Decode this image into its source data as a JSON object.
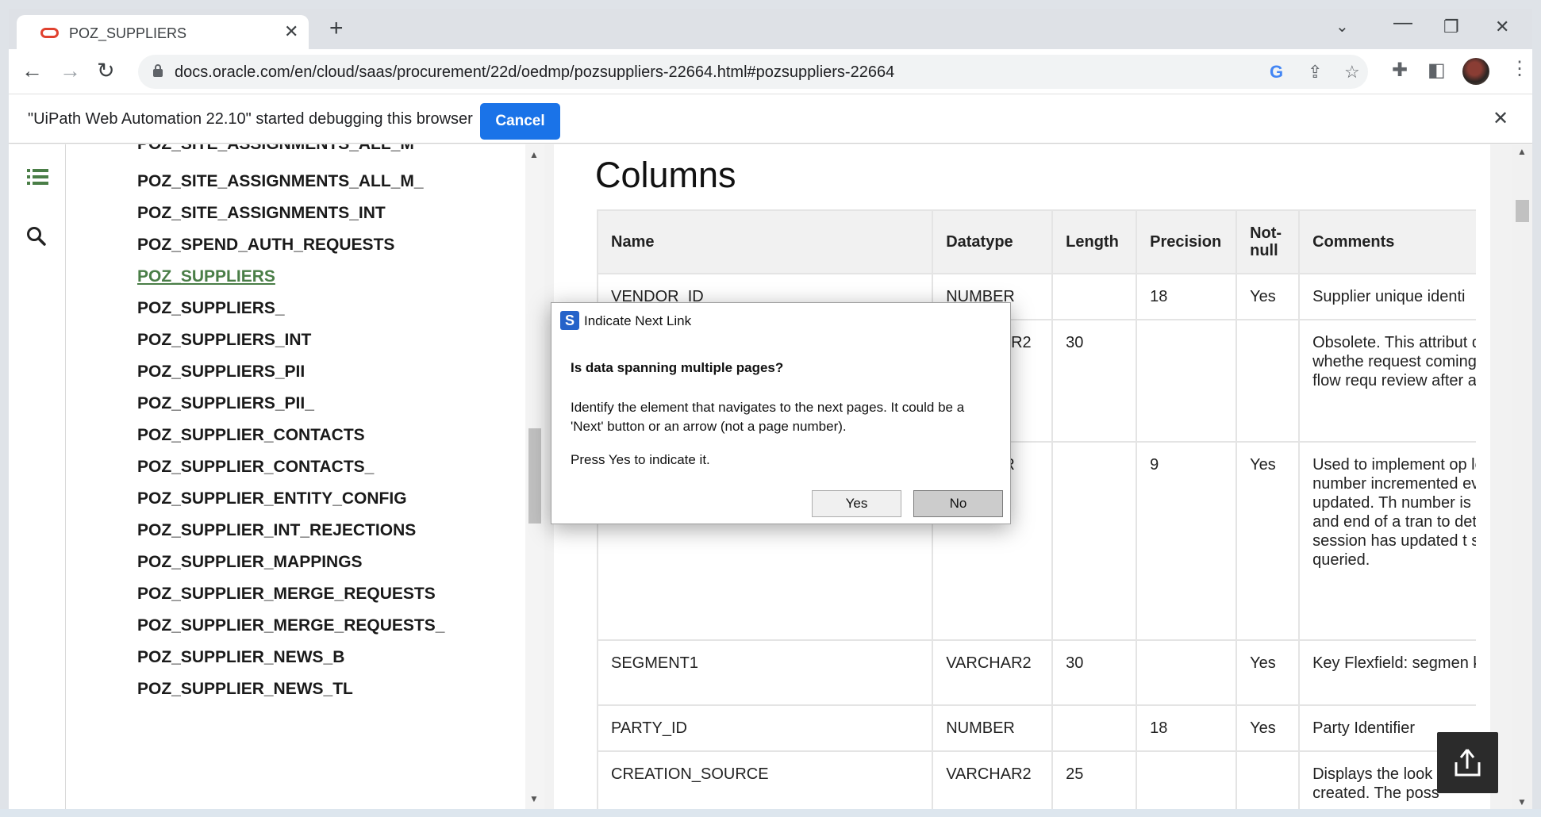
{
  "browser": {
    "tab_title": "POZ_SUPPLIERS",
    "tab_close": "✕",
    "new_tab": "+",
    "url": "docs.oracle.com/en/cloud/saas/procurement/22d/oedmp/pozsuppliers-22664.html#pozsuppliers-22664",
    "accent_color": "#1a73e8"
  },
  "infobar": {
    "message": "\"UiPath Web Automation 22.10\" started debugging this browser",
    "cancel_label": "Cancel"
  },
  "sidebar": {
    "items": [
      {
        "label": "POZ_SITE_ASSIGNMENTS_ALL_M"
      },
      {
        "label": "POZ_SITE_ASSIGNMENTS_ALL_M_"
      },
      {
        "label": "POZ_SITE_ASSIGNMENTS_INT"
      },
      {
        "label": "POZ_SPEND_AUTH_REQUESTS"
      },
      {
        "label": "POZ_SUPPLIERS",
        "active": true
      },
      {
        "label": "POZ_SUPPLIERS_"
      },
      {
        "label": "POZ_SUPPLIERS_INT"
      },
      {
        "label": "POZ_SUPPLIERS_PII"
      },
      {
        "label": "POZ_SUPPLIERS_PII_"
      },
      {
        "label": "POZ_SUPPLIER_CONTACTS"
      },
      {
        "label": "POZ_SUPPLIER_CONTACTS_"
      },
      {
        "label": "POZ_SUPPLIER_ENTITY_CONFIG"
      },
      {
        "label": "POZ_SUPPLIER_INT_REJECTIONS"
      },
      {
        "label": "POZ_SUPPLIER_MAPPINGS"
      },
      {
        "label": "POZ_SUPPLIER_MERGE_REQUESTS"
      },
      {
        "label": "POZ_SUPPLIER_MERGE_REQUESTS_"
      },
      {
        "label": "POZ_SUPPLIER_NEWS_B"
      },
      {
        "label": "POZ_SUPPLIER_NEWS_TL"
      }
    ],
    "active_color": "#4a7e47"
  },
  "content": {
    "heading": "Columns",
    "table": {
      "headers": [
        "Name",
        "Datatype",
        "Length",
        "Precision",
        "Not-null",
        "Comments"
      ],
      "rows": [
        [
          "VENDOR_ID",
          "NUMBER",
          "",
          "18",
          "Yes",
          "Supplier unique identi"
        ],
        [
          "",
          "VARCHAR2",
          "30",
          "",
          "",
          "Obsolete. This attribut data to denote whethe request coming from Registration flow requ review after approval"
        ],
        [
          "",
          "NUMBER",
          "",
          "9",
          "Yes",
          "Used to implement op locking. This number incremented every tim the row is updated. Th number is compared a start and end of a tran to detect whether ano session has updated t since it was queried."
        ],
        [
          "SEGMENT1",
          "VARCHAR2",
          "30",
          "",
          "Yes",
          "Key Flexfield: segmen key flexfield."
        ],
        [
          "PARTY_ID",
          "NUMBER",
          "",
          "18",
          "Yes",
          "Party Identifier"
        ],
        [
          "CREATION_SOURCE",
          "VARCHAR2",
          "25",
          "",
          "",
          "Displays the look source from which was created. The poss"
        ]
      ]
    }
  },
  "dialog": {
    "title": "Indicate Next Link",
    "icon_letter": "S",
    "question": "Is data spanning multiple pages?",
    "body": "Identify the element that navigates to the next pages. It could be a 'Next' button or an arrow (not a page number).",
    "press": "Press Yes to indicate it.",
    "yes_label": "Yes",
    "no_label": "No"
  }
}
